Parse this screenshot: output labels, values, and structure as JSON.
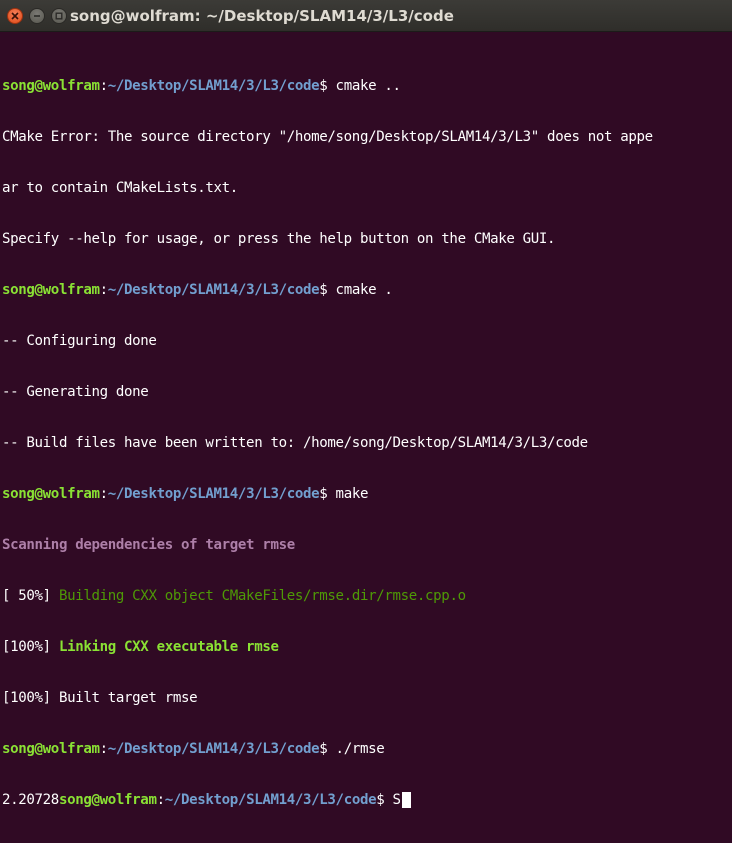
{
  "window": {
    "title": "song@wolfram: ~/Desktop/SLAM14/3/L3/code"
  },
  "prompt": {
    "user_host": "song@wolfram",
    "sep": ":",
    "path": "~/Desktop/SLAM14/3/L3/code",
    "symbol": "$"
  },
  "lines": {
    "cmd1": " cmake ..",
    "err1": "CMake Error: The source directory \"/home/song/Desktop/SLAM14/3/L3\" does not appe",
    "err2": "ar to contain CMakeLists.txt.",
    "err3": "Specify --help for usage, or press the help button on the CMake GUI.",
    "cmd2": " cmake .",
    "out1": "-- Configuring done",
    "out2": "-- Generating done",
    "out3": "-- Build files have been written to: /home/song/Desktop/SLAM14/3/L3/code",
    "cmd3": " make",
    "scan": "Scanning dependencies of target rmse",
    "build_pct": "[ 50%] ",
    "build_msg": "Building CXX object CMakeFiles/rmse.dir/rmse.cpp.o",
    "link_pct": "[100%] ",
    "link_msg": "Linking CXX executable rmse",
    "built": "[100%] Built target rmse",
    "cmd4": " ./rmse",
    "result": "2.20728",
    "typed": " S"
  },
  "colors": {
    "background": "#300a24",
    "prompt_user": "#8ae234",
    "prompt_path": "#729fcf",
    "scan": "#ad7fa8",
    "build": "#4e9a06"
  }
}
